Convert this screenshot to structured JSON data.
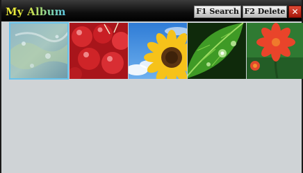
{
  "titlebar": {
    "title": "My Album",
    "search_label": "F1 Search",
    "delete_label": "F2 Delete",
    "close_glyph": "✕"
  },
  "thumbnails": [
    {
      "name": "thumb-water",
      "depicts": "water-droplets",
      "selected": true
    },
    {
      "name": "thumb-cherries",
      "depicts": "cherries",
      "selected": false
    },
    {
      "name": "thumb-sunflower",
      "depicts": "sunflower",
      "selected": false
    },
    {
      "name": "thumb-leaf",
      "depicts": "green-leaf",
      "selected": false
    },
    {
      "name": "thumb-red-flower",
      "depicts": "red-flower",
      "selected": false
    }
  ],
  "colors": {
    "background": "#cfd3d6",
    "selection": "#66c2ec",
    "close": "#c42a1b"
  }
}
